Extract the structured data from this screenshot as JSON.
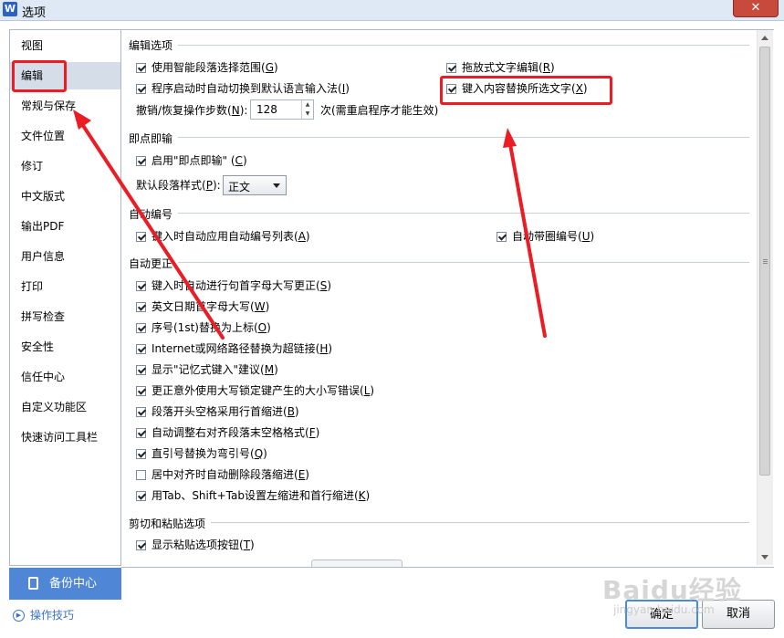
{
  "window": {
    "title": "选项",
    "app_icon": "W",
    "close_glyph": "✕"
  },
  "sidebar": {
    "items": [
      {
        "label": "视图"
      },
      {
        "label": "编辑",
        "selected": true
      },
      {
        "label": "常规与保存"
      },
      {
        "label": "文件位置"
      },
      {
        "label": "修订"
      },
      {
        "label": "中文版式"
      },
      {
        "label": "输出PDF"
      },
      {
        "label": "用户信息"
      },
      {
        "label": "打印"
      },
      {
        "label": "拼写检查"
      },
      {
        "label": "安全性"
      },
      {
        "label": "信任中心"
      },
      {
        "label": "自定义功能区"
      },
      {
        "label": "快速访问工具栏"
      }
    ],
    "backup_label": "备份中心",
    "tips_label": "操作技巧"
  },
  "sections": {
    "edit": {
      "title": "编辑选项",
      "smart_select": {
        "label": "使用智能段落选择范围(",
        "key": "G",
        "end": ")",
        "checked": true
      },
      "drag_drop": {
        "label": "拖放式文字编辑(",
        "key": "R",
        "end": ")",
        "checked": true
      },
      "auto_ime": {
        "label": "程序启动时自动切换到默认语言输入法(",
        "key": "I",
        "end": ")",
        "checked": true
      },
      "replace_sel": {
        "label": "键入内容替换所选文字(",
        "key": "X",
        "end": ")",
        "checked": true
      },
      "undo_label": "撤销/恢复操作步数(",
      "undo_key": "N",
      "undo_end": "):",
      "undo_value": "128",
      "undo_suffix": "次(需重启程序才能生效)"
    },
    "click_type": {
      "title": "即点即输",
      "enable": {
        "label": "启用\"即点即输\" (",
        "key": "C",
        "end": ")",
        "checked": true
      },
      "style_label": "默认段落样式(",
      "style_key": "P",
      "style_end": "):",
      "style_value": "正文"
    },
    "auto_number": {
      "title": "自动编号",
      "auto_list": {
        "label": "键入时自动应用自动编号列表(",
        "key": "A",
        "end": ")",
        "checked": true
      },
      "circle_num": {
        "label": "自动带圈编号(",
        "key": "U",
        "end": ")",
        "checked": true
      }
    },
    "autocorrect": {
      "title": "自动更正",
      "items": [
        {
          "label": "键入时自动进行句首字母大写更正(",
          "key": "S",
          "end": ")",
          "checked": true
        },
        {
          "label": "英文日期首字母大写(",
          "key": "W",
          "end": ")",
          "checked": true
        },
        {
          "label": "序号(1st)替换为上标(",
          "key": "O",
          "end": ")",
          "checked": true
        },
        {
          "label": "Internet或网络路径替换为超链接(",
          "key": "H",
          "end": ")",
          "checked": true
        },
        {
          "label": "显示\"记忆式键入\"建议(",
          "key": "M",
          "end": ")",
          "checked": true
        },
        {
          "label": "更正意外使用大写锁定键产生的大小写错误(",
          "key": "L",
          "end": ")",
          "checked": true
        },
        {
          "label": "段落开头空格采用行首缩进(",
          "key": "B",
          "end": ")",
          "checked": true
        },
        {
          "label": "自动调整右对齐段落末空格格式(",
          "key": "F",
          "end": ")",
          "checked": true
        },
        {
          "label": "直引号替换为弯引号(",
          "key": "Q",
          "end": ")",
          "checked": true
        },
        {
          "label": "居中对齐时自动删除段落缩进(",
          "key": "E",
          "end": ")",
          "checked": false
        },
        {
          "label": "用Tab、Shift+Tab设置左缩进和首行缩进(",
          "key": "K",
          "end": ")",
          "checked": true
        }
      ]
    },
    "paste": {
      "title": "剪切和粘贴选项",
      "show_btn": {
        "label": "显示粘贴选项按钮(",
        "key": "T",
        "end": ")",
        "checked": true
      }
    }
  },
  "buttons": {
    "ok": "确定",
    "cancel": "取消"
  },
  "watermark": {
    "text": "Baidu经验",
    "url": "jingyan.baidu.com"
  },
  "annotation_color": "#ec1c24"
}
